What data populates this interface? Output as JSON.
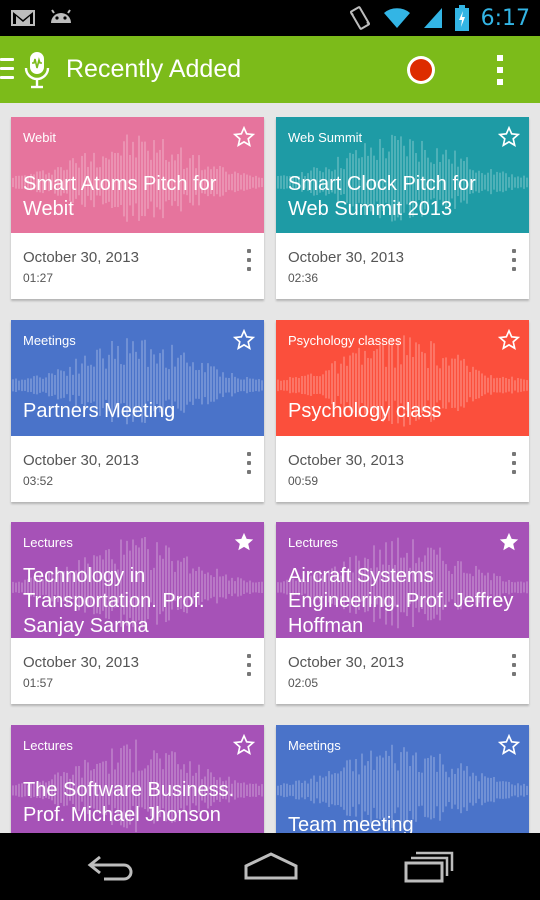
{
  "status_bar": {
    "time": "6:17",
    "left_icons": [
      "gmail-icon",
      "android-icon"
    ],
    "right_icons": [
      "vibrate-icon",
      "wifi-icon",
      "signal-icon",
      "battery-charging-icon"
    ]
  },
  "action_bar": {
    "title": "Recently Added",
    "color": "#7cbb1a",
    "icons": [
      "menu-icon",
      "mic-icon",
      "record-icon",
      "overflow-icon"
    ]
  },
  "recordings": [
    {
      "category": "Webit",
      "title": "Smart Atoms Pitch for Webit",
      "date": "October 30, 2013",
      "duration": "01:27",
      "color": "#e6749d",
      "starred": false
    },
    {
      "category": "Web Summit",
      "title": "Smart Clock Pitch for Web Summit 2013",
      "date": "October 30, 2013",
      "duration": "02:36",
      "color": "#1e9ba5",
      "starred": false
    },
    {
      "category": "Meetings",
      "title": "Partners Meeting",
      "date": "October 30, 2013",
      "duration": "03:52",
      "color": "#4a73c9",
      "starred": false
    },
    {
      "category": "Psychology classes",
      "title": "Psychology class",
      "date": "October 30, 2013",
      "duration": "00:59",
      "color": "#fb4f3c",
      "starred": false
    },
    {
      "category": "Lectures",
      "title": "Technology in Transportation. Prof. Sanjay Sarma",
      "date": "October 30, 2013",
      "duration": "01:57",
      "color": "#a652b7",
      "starred": true
    },
    {
      "category": "Lectures",
      "title": "Aircraft Systems Engineering. Prof. Jeffrey Hoffman",
      "date": "October 30, 2013",
      "duration": "02:05",
      "color": "#a652b7",
      "starred": true
    },
    {
      "category": "Lectures",
      "title": "The Software Business. Prof. Michael Jhonson",
      "date": "",
      "duration": "",
      "color": "#a652b7",
      "starred": false
    },
    {
      "category": "Meetings",
      "title": "Team meeting",
      "date": "",
      "duration": "",
      "color": "#4a73c9",
      "starred": false
    }
  ],
  "nav_bar": {
    "icons": [
      "back-icon",
      "home-icon",
      "recent-apps-icon"
    ]
  }
}
